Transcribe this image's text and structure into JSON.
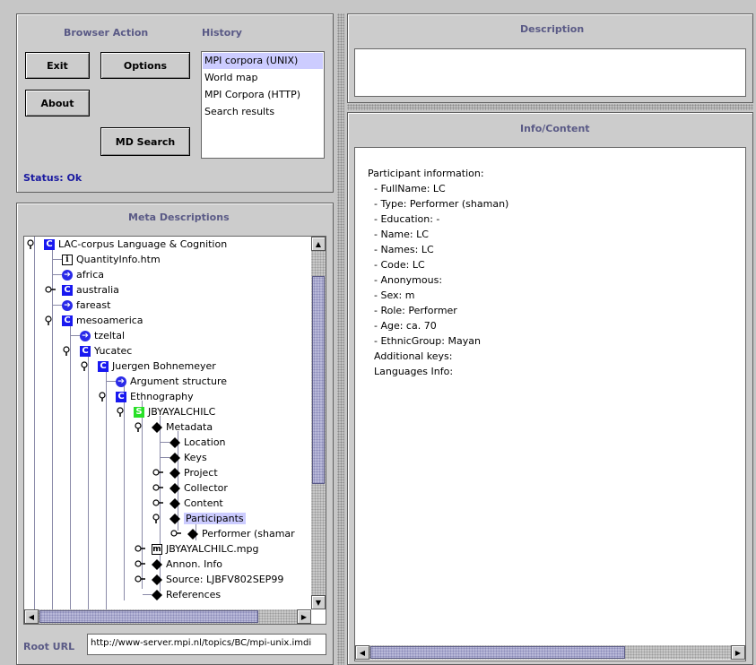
{
  "browser_panel": {
    "title": "Browser Action",
    "history_title": "History",
    "buttons": {
      "exit": "Exit",
      "options": "Options",
      "about": "About",
      "md_search": "MD Search"
    },
    "history": [
      "MPI corpora (UNIX)",
      "World map",
      "MPI Corpora (HTTP)",
      "Search results"
    ],
    "status": "Status: Ok"
  },
  "meta_panel": {
    "title": "Meta Descriptions",
    "root_url_label": "Root URL",
    "root_url_value": "http://www-server.mpi.nl/topics/BC/mpi-unix.imdi"
  },
  "tree": [
    {
      "label": "LAC-corpus Language & Cognition",
      "icon": "corpus-icon"
    },
    {
      "label": "QuantityInfo.htm",
      "icon": "info-file-icon"
    },
    {
      "label": "africa",
      "icon": "link-arrow-icon"
    },
    {
      "label": "australia",
      "icon": "corpus-icon"
    },
    {
      "label": "fareast",
      "icon": "link-arrow-icon"
    },
    {
      "label": "mesoamerica",
      "icon": "corpus-icon"
    },
    {
      "label": "tzeltal",
      "icon": "link-arrow-icon"
    },
    {
      "label": "Yucatec",
      "icon": "corpus-icon"
    },
    {
      "label": "Juergen Bohnemeyer",
      "icon": "corpus-icon"
    },
    {
      "label": "Argument structure",
      "icon": "link-arrow-icon"
    },
    {
      "label": "Ethnography",
      "icon": "corpus-icon"
    },
    {
      "label": "JBYAYALCHILC",
      "icon": "session-icon"
    },
    {
      "label": "Metadata",
      "icon": "diamond-icon"
    },
    {
      "label": "Location",
      "icon": "diamond-icon"
    },
    {
      "label": "Keys",
      "icon": "diamond-icon"
    },
    {
      "label": "Project",
      "icon": "diamond-icon"
    },
    {
      "label": "Collector",
      "icon": "diamond-icon"
    },
    {
      "label": "Content",
      "icon": "diamond-icon"
    },
    {
      "label": "Participants",
      "icon": "diamond-icon"
    },
    {
      "label": "Performer (shamar",
      "icon": "diamond-icon"
    },
    {
      "label": "JBYAYALCHILC.mpg",
      "icon": "media-file-icon"
    },
    {
      "label": "Annon. Info",
      "icon": "diamond-icon"
    },
    {
      "label": "Source: LJBFV802SEP99",
      "icon": "diamond-icon"
    },
    {
      "label": "References",
      "icon": "diamond-icon"
    }
  ],
  "description_panel": {
    "title": "Description",
    "text": ""
  },
  "info_panel": {
    "title": "Info/Content",
    "lines": [
      "Participant information:",
      "  - FullName: LC",
      "  - Type: Performer (shaman)",
      "  - Education: -",
      "  - Name: LC",
      "  - Names: LC",
      "  - Code: LC",
      "  - Anonymous:",
      "  - Sex: m",
      "  - Role: Performer",
      "  - Age: ca. 70",
      "  - EthnicGroup: Mayan",
      "  Additional keys:",
      "  Languages Info:"
    ]
  },
  "colors": {
    "panel_bg": "#cccccc",
    "header_text": "#5a5a86",
    "status_text": "#1a1aa0",
    "selection": "#ccccff",
    "corpus_icon": "#1818f0",
    "session_icon": "#28e028"
  }
}
